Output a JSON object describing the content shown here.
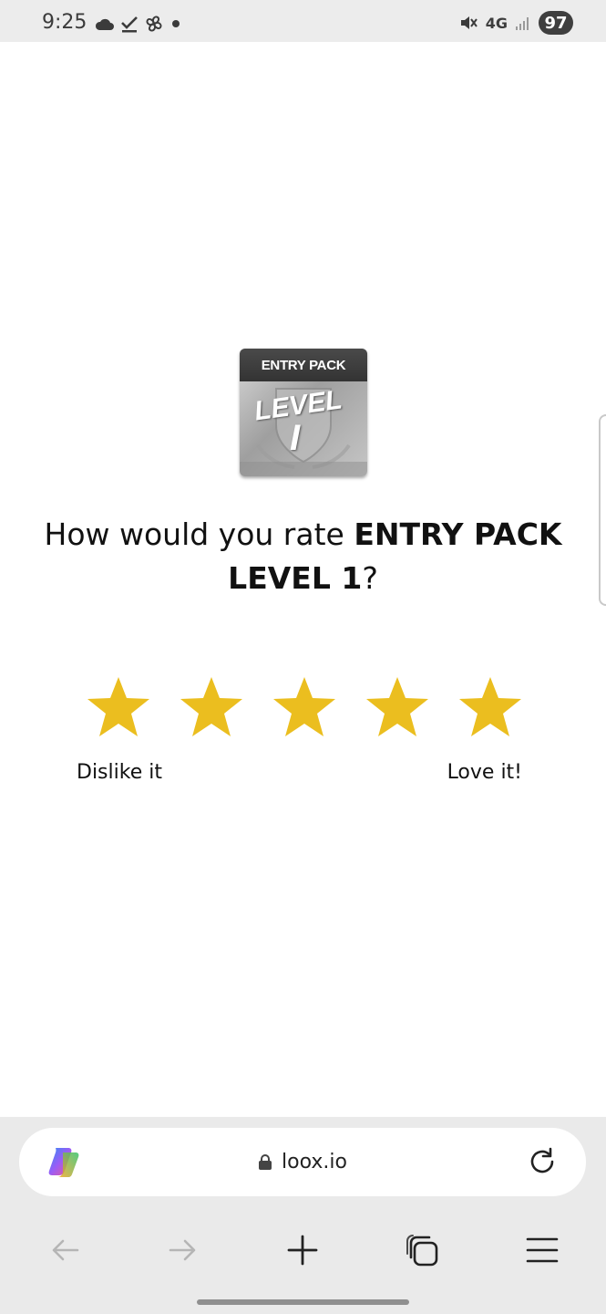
{
  "status_bar": {
    "time": "9:25",
    "network": "4G",
    "battery": "97"
  },
  "product": {
    "badge_top": "ENTRY PACK",
    "badge_level": "LEVEL",
    "badge_num": "I"
  },
  "question": {
    "prefix": "How would you rate ",
    "product_name": "ENTRY PACK LEVEL 1",
    "suffix": "?"
  },
  "rating": {
    "stars_total": 5,
    "star_color": "#EBBE1F",
    "label_low": "Dislike it",
    "label_high": "Love it!"
  },
  "browser": {
    "url": "loox.io",
    "nav": [
      "back-icon",
      "forward-icon",
      "new-tab-icon",
      "tabs-icon",
      "menu-icon"
    ]
  }
}
